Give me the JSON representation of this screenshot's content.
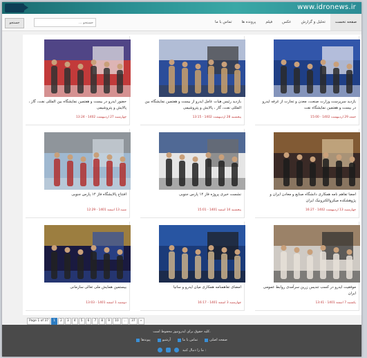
{
  "header": {
    "site": "www.idronews.ir"
  },
  "nav": [
    "صفحه نخست",
    "تحلیل و گزارش",
    "عکس",
    "فیلم",
    "پرونده ها",
    "تماس با ما"
  ],
  "search": {
    "placeholder": "جستجو ...",
    "button": "جستجو"
  },
  "cards": [
    {
      "title": "بازدید سرپرست وزارت صنعت، معدن و تجارت از غرفه ایدرو در بیست و هفتمین نمایشگاه نفت",
      "date": "جمعه 29 اردیبهشت 1402 - 15:00",
      "photo": "expo-booth-blue"
    },
    {
      "title": "بازدید رئیس هیات عامل ایدرو از بیست و هفتمین نمایشگاه بین المللی نفت، گاز ، پالایش و پتروشیمی",
      "date": "پنجشنبه 28 اردیبهشت 1402 - 13:15",
      "photo": "expo-visit"
    },
    {
      "title": "حضور ایدرو در بیست و هفتمین نمایشگاه بین المللی نفت، گاز ، پالایش و پتروشیمی",
      "date": "چهارشنبه 27 اردیبهشت 1402 - 13:24",
      "photo": "expo-hall"
    },
    {
      "title": "امضا تفاهم نامه همکاری دانشگاه صنایع و معادن ایران و پژوهشکده میکروالکترونیک ایران",
      "date": "چهارشنبه 13 اردیبهشت 1402 - 16:27",
      "photo": "signing-mou"
    },
    {
      "title": "نشست خبری پروژه فاز ۱۴ پارس جنوبی",
      "date": "پنجشنبه 14 اسفند 1401 - 15:01",
      "photo": "press-conference"
    },
    {
      "title": "افتتاح پالایشگاه فاز ۱۴ پارس جنوبی",
      "date": "شنبه 13 اسفند 1401 - 12:29",
      "photo": "refinery"
    },
    {
      "title": "موفقیت ایدرو در کسب تندیس زرین سرآمدی روابط عمومی ایران",
      "date": "یکشنبه 7 اسفند 1401 - 13:41",
      "photo": "award-group"
    },
    {
      "title": "امضای تفاهمنامه همکاری میان ایدرو و ساتیا",
      "date": "چهارشنبه 3 اسفند 1401 - 16:17",
      "photo": "signing-group"
    },
    {
      "title": "بیستمین همایش ملی تعالی سازمانی",
      "date": "دوشنبه 1 اسفند 1401 - 13:03",
      "photo": "conference-stage"
    }
  ],
  "pager": [
    "Page 1 of 37",
    "1",
    "2",
    "3",
    "4",
    "5",
    "6",
    "7",
    "8",
    "9",
    "10",
    "...",
    "37",
    "»"
  ],
  "footer": {
    "copyright": "کلیه حقوق برای ایدرو‌نیوز محفوظ است.",
    "links": [
      "صفحه اصلی",
      "تماس با ما",
      "آرشیو",
      "پیوندها"
    ],
    "follow": "ما را دنبال کنید :"
  },
  "colors": {
    "header": "#2a8f92",
    "date": "#c03333",
    "pager_active": "#2d7cc1",
    "footer": "#4a4a4a"
  }
}
